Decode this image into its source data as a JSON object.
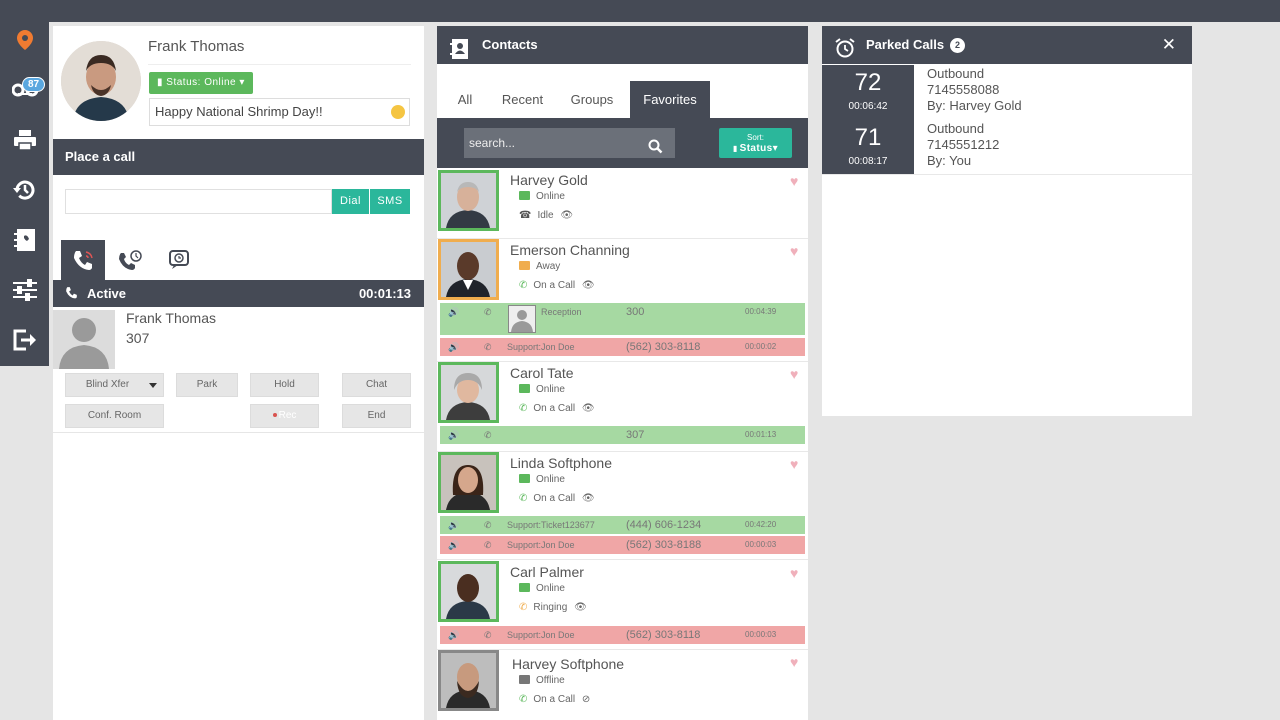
{
  "sidebar": {
    "badge_count": "87",
    "items": [
      {
        "icon": "location-pin-icon"
      },
      {
        "icon": "voicemail-icon"
      },
      {
        "icon": "fax-printer-icon"
      },
      {
        "icon": "history-icon"
      },
      {
        "icon": "contacts-book-icon"
      },
      {
        "icon": "settings-sliders-icon"
      },
      {
        "icon": "logout-icon"
      }
    ]
  },
  "profile": {
    "name": "Frank Thomas",
    "status_label": "Status: Online",
    "status_message": "Happy National Shrimp Day!!"
  },
  "place_call": {
    "title": "Place a call",
    "dial_value": "",
    "dial_label": "Dial",
    "sms_label": "SMS"
  },
  "active_call": {
    "title": "Active",
    "timer": "00:01:13",
    "caller_name": "Frank Thomas",
    "caller_ext": "307",
    "buttons": {
      "blind_xfer": "Blind Xfer",
      "park": "Park",
      "hold": "Hold",
      "chat": "Chat",
      "conf_room": "Conf. Room",
      "rec": "Rec",
      "end": "End"
    }
  },
  "contacts": {
    "title": "Contacts",
    "tabs": [
      "All",
      "Recent",
      "Groups",
      "Favorites"
    ],
    "selected_tab": "Favorites",
    "search_placeholder": "search...",
    "sort_top": "Sort:",
    "sort_value": "Status",
    "list": [
      {
        "name": "Harvey Gold",
        "presence": "Online",
        "call_state": "Idle"
      },
      {
        "name": "Emerson Channing",
        "presence": "Away",
        "call_state": "On a Call"
      },
      {
        "name": "Carol Tate",
        "presence": "Online",
        "call_state": "On a Call"
      },
      {
        "name": "Linda Softphone",
        "presence": "Online",
        "call_state": "On a Call"
      },
      {
        "name": "Carl Palmer",
        "presence": "Online",
        "call_state": "Ringing"
      },
      {
        "name": "Harvey Softphone",
        "presence": "Offline",
        "call_state": "On a Call"
      }
    ],
    "calls": {
      "emerson_1": {
        "label": "Reception",
        "number": "300",
        "time": "00:04:39"
      },
      "emerson_2": {
        "label": "Support:Jon Doe",
        "number": "(562) 303-8118",
        "time": "00:00:02"
      },
      "carol_1": {
        "label": "",
        "number": "307",
        "time": "00:01:13"
      },
      "linda_1": {
        "label": "Support:Ticket123677",
        "number": "(444) 606-1234",
        "time": "00:42:20"
      },
      "linda_2": {
        "label": "Support:Jon Doe",
        "number": "(562) 303-8188",
        "time": "00:00:03"
      },
      "carl_1": {
        "label": "Support:Jon Doe",
        "number": "(562) 303-8118",
        "time": "00:00:03"
      }
    },
    "colors": {
      "online": "#5cb85c",
      "away": "#f0ad4e",
      "offline": "#888888",
      "call_green": "#a6d9a2",
      "call_red": "#f0a6a6"
    }
  },
  "parked": {
    "title": "Parked Calls",
    "count": "2",
    "calls": [
      {
        "slot": "72",
        "time": "00:06:42",
        "direction": "Outbound",
        "number": "7145558088",
        "by": "By: Harvey Gold"
      },
      {
        "slot": "71",
        "time": "00:08:17",
        "direction": "Outbound",
        "number": "7145551212",
        "by": "By: You"
      }
    ]
  },
  "colors": {
    "header": "#454a55",
    "teal": "#2bb79b",
    "green": "#5cb85c"
  }
}
